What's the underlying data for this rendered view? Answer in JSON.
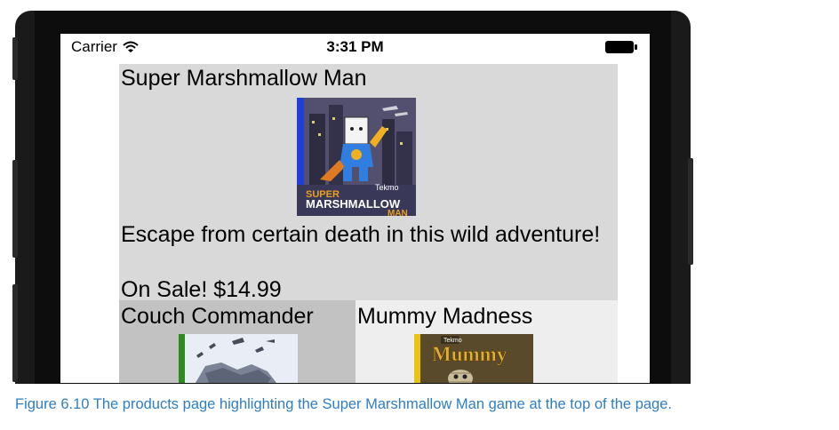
{
  "status_bar": {
    "carrier": "Carrier",
    "time": "3:31 PM"
  },
  "featured": {
    "title": "Super Marshmallow Man",
    "art_logo_small": "Tekmo",
    "art_logo_line1": "SUPER",
    "art_logo_line2": "MARSHMALLOW",
    "art_logo_line3": "MAN",
    "description": "Escape from certain death in this wild adventure!",
    "price": "On Sale! $14.99",
    "stripe_color": "#1f3fd6"
  },
  "products": [
    {
      "title": "Couch Commander",
      "stripe_color": "#2e8b1f"
    },
    {
      "title": "Mummy Madness",
      "stripe_color": "#e8c410",
      "art_logo_small": "Tekmo",
      "art_logo_title": "Mummy"
    }
  ],
  "caption": "Figure 6.10 The products page highlighting the Super Marshmallow Man game at the top of the page.",
  "colors": {
    "caption": "#2f7ec1",
    "featured_bg": "#d9d9d9",
    "product_left_bg": "#c2c2c2",
    "product_right_bg": "#eeeeee"
  }
}
